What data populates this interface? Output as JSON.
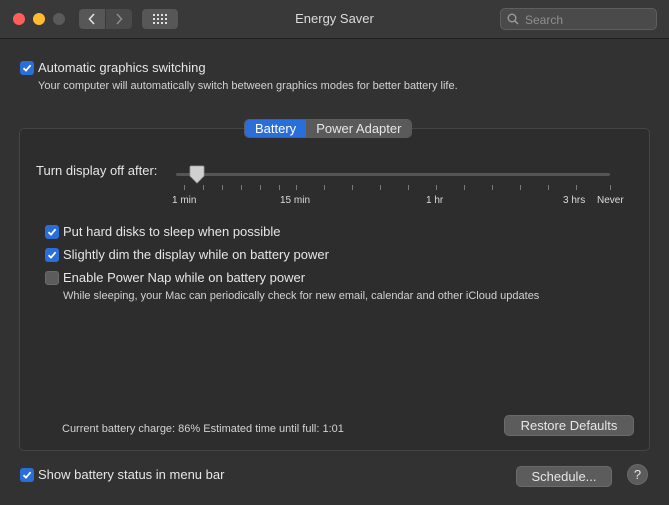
{
  "window": {
    "title": "Energy Saver",
    "search_placeholder": "Search"
  },
  "graphics_switching": {
    "label": "Automatic graphics switching",
    "checked": true,
    "description": "Your computer will automatically switch between graphics modes for better battery life."
  },
  "tabs": [
    {
      "label": "Battery",
      "active": true
    },
    {
      "label": "Power Adapter",
      "active": false
    }
  ],
  "display_sleep": {
    "label": "Turn display off after:",
    "ticks": [
      "1 min",
      "15 min",
      "1 hr",
      "3 hrs",
      "Never"
    ],
    "selected": "1 min"
  },
  "options": [
    {
      "label": "Put hard disks to sleep when possible",
      "checked": true
    },
    {
      "label": "Slightly dim the display while on battery power",
      "checked": true
    },
    {
      "label": "Enable Power Nap while on battery power",
      "checked": false,
      "description": "While sleeping, your Mac can periodically check for new email, calendar and other iCloud updates"
    }
  ],
  "battery_status": "Current battery charge: 86%  Estimated time until full: 1:01",
  "buttons": {
    "restore_defaults": "Restore Defaults",
    "schedule": "Schedule...",
    "help": "?"
  },
  "menu_bar_status": {
    "label": "Show battery status in menu bar",
    "checked": true
  },
  "colors": {
    "accent": "#2a6fd9",
    "background": "#323232"
  }
}
